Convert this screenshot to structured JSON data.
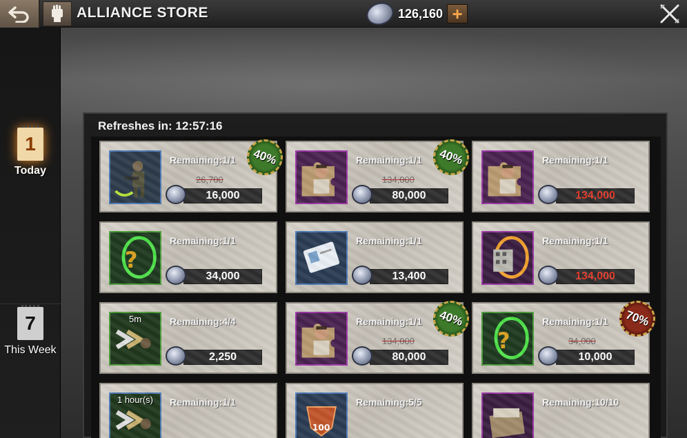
{
  "header": {
    "title": "ALLIANCE STORE",
    "currency_value": "126,160",
    "plus_label": "+",
    "back_icon": "back-arrow-icon",
    "close_icon": "close-icon"
  },
  "sidebar": {
    "tabs": [
      {
        "label": "Today",
        "day": "1",
        "icon": "calendar-icon",
        "active": true
      },
      {
        "label": "This Week",
        "day": "7",
        "icon": "calendar-icon",
        "active": false
      }
    ]
  },
  "store": {
    "refresh_label": "Refreshes in: 12:57:16",
    "items": [
      {
        "icon": "soldier-icon",
        "frame": "blue",
        "time": "",
        "remaining": "Remaining:1/1",
        "old_price": "26,700",
        "price": "16,000",
        "price_red": false,
        "discount": "40%",
        "discount_color": "green"
      },
      {
        "icon": "hero-puzzle-icon",
        "frame": "purple",
        "time": "",
        "remaining": "Remaining:1/1",
        "old_price": "134,000",
        "price": "80,000",
        "price_red": false,
        "discount": "40%",
        "discount_color": "green"
      },
      {
        "icon": "hero-puzzle-icon",
        "frame": "purple",
        "time": "",
        "remaining": "Remaining:1/1",
        "old_price": "",
        "price": "134,000",
        "price_red": true,
        "discount": "",
        "discount_color": ""
      },
      {
        "icon": "mystery-portal-icon",
        "frame": "green",
        "time": "",
        "remaining": "Remaining:1/1",
        "old_price": "",
        "price": "34,000",
        "price_red": false,
        "discount": "",
        "discount_color": ""
      },
      {
        "icon": "id-card-icon",
        "frame": "blue",
        "time": "",
        "remaining": "Remaining:1/1",
        "old_price": "",
        "price": "13,400",
        "price_red": false,
        "discount": "",
        "discount_color": ""
      },
      {
        "icon": "building-portal-icon",
        "frame": "purple",
        "time": "",
        "remaining": "Remaining:1/1",
        "old_price": "",
        "price": "134,000",
        "price_red": true,
        "discount": "",
        "discount_color": ""
      },
      {
        "icon": "speedup-icon",
        "frame": "green",
        "time": "5m",
        "remaining": "Remaining:4/4",
        "old_price": "",
        "price": "2,250",
        "price_red": false,
        "discount": "",
        "discount_color": ""
      },
      {
        "icon": "hero-puzzle-icon",
        "frame": "purple",
        "time": "",
        "remaining": "Remaining:1/1",
        "old_price": "134,000",
        "price": "80,000",
        "price_red": false,
        "discount": "40%",
        "discount_color": "green"
      },
      {
        "icon": "mystery-portal-icon",
        "frame": "green",
        "time": "",
        "remaining": "Remaining:1/1",
        "old_price": "34,000",
        "price": "10,000",
        "price_red": false,
        "discount": "70%",
        "discount_color": "red"
      },
      {
        "icon": "speedup-icon",
        "frame": "blue",
        "time": "1 hour(s)",
        "remaining": "Remaining:1/1",
        "old_price": "",
        "price": "",
        "price_red": false,
        "discount": "",
        "discount_color": ""
      },
      {
        "icon": "medal-100-icon",
        "frame": "blue",
        "time": "",
        "remaining": "Remaining:5/5",
        "old_price": "",
        "price": "",
        "price_red": false,
        "discount": "",
        "discount_color": ""
      },
      {
        "icon": "supply-crate-icon",
        "frame": "purple",
        "time": "",
        "remaining": "Remaining:10/10",
        "old_price": "",
        "price": "",
        "price_red": false,
        "discount": "",
        "discount_color": ""
      }
    ]
  },
  "colors": {
    "price_red": "#e23a2a",
    "discount_green": "#3d7a2a",
    "discount_red": "#8a2a1a",
    "frame_blue": "#4b77b4",
    "frame_purple": "#9a36a6",
    "frame_green": "#4a9a3a"
  }
}
